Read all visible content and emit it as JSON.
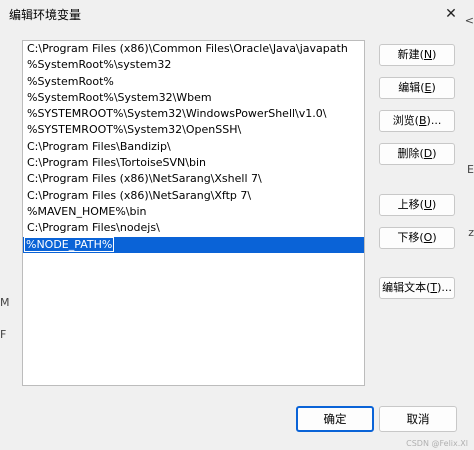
{
  "window": {
    "title": "编辑环境变量",
    "close_glyph": "✕"
  },
  "list": {
    "items": [
      "C:\\Program Files (x86)\\Common Files\\Oracle\\Java\\javapath",
      "%SystemRoot%\\system32",
      "%SystemRoot%",
      "%SystemRoot%\\System32\\Wbem",
      "%SYSTEMROOT%\\System32\\WindowsPowerShell\\v1.0\\",
      "%SYSTEMROOT%\\System32\\OpenSSH\\",
      "C:\\Program Files\\Bandizip\\",
      "C:\\Program Files\\TortoiseSVN\\bin",
      "C:\\Program Files (x86)\\NetSarang\\Xshell 7\\",
      "C:\\Program Files (x86)\\NetSarang\\Xftp 7\\",
      "%MAVEN_HOME%\\bin",
      "C:\\Program Files\\nodejs\\"
    ],
    "editing_value": "%NODE_PATH%"
  },
  "buttons": {
    "new": {
      "label": "新建(",
      "key": "N",
      "close": ")"
    },
    "edit": {
      "label": "编辑(",
      "key": "E",
      "close": ")"
    },
    "browse": {
      "label": "浏览(",
      "key": "B",
      "close": ")..."
    },
    "delete": {
      "label": "删除(",
      "key": "D",
      "close": ")"
    },
    "up": {
      "label": "上移(",
      "key": "U",
      "close": ")"
    },
    "down": {
      "label": "下移(",
      "key": "O",
      "close": ")"
    },
    "edit_text": {
      "label": "编辑文本(",
      "key": "T",
      "close": ")..."
    },
    "ok": "确定",
    "cancel": "取消"
  },
  "edge_fragments": {
    "right_1": "<",
    "right_2": "E",
    "right_3": "z",
    "left_1": "M",
    "left_2": "F"
  },
  "watermark": "CSDN @Felix.Xl"
}
